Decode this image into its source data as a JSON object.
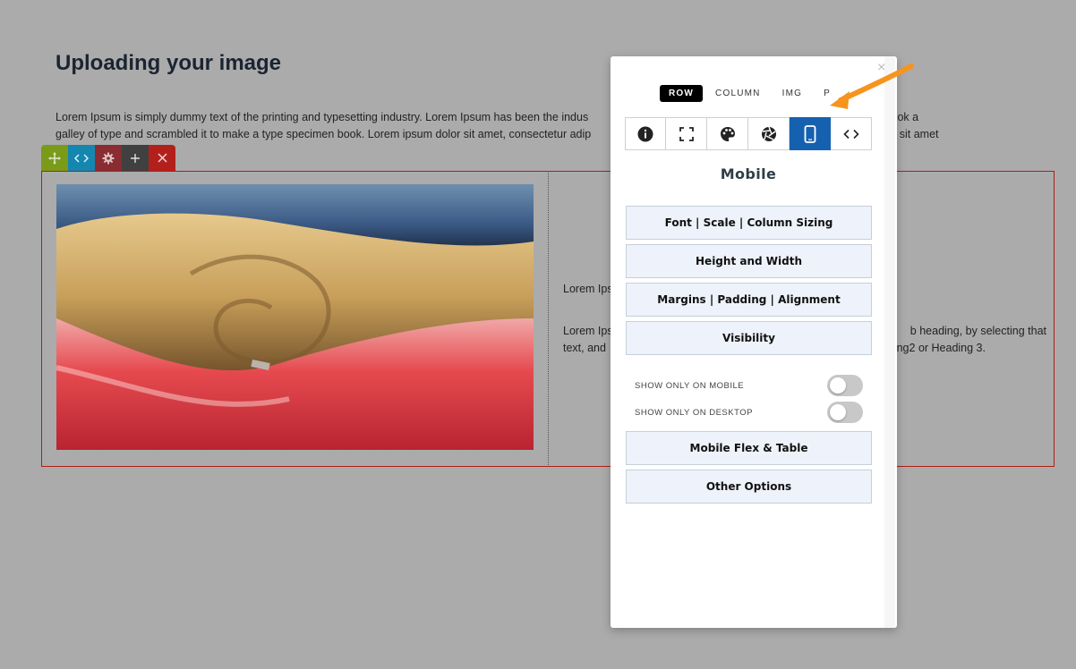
{
  "page": {
    "title": "Uploading your image",
    "intro_line1": "Lorem Ipsum is simply dummy text of the printing and typesetting industry. Lorem Ipsum has been the indus",
    "intro_line1_end": "n unknown printer took a",
    "intro_line2": "galley of type and scrambled it to make a type specimen book. Lorem ipsum dolor sit amet, consectetur adip",
    "intro_line2_end": "tate vel, dapibus sit amet"
  },
  "row_toolbar": {
    "move_icon": "move-icon",
    "code_icon": "code-icon",
    "settings_icon": "gear-icon",
    "add_icon": "plus-icon",
    "delete_icon": "close-icon"
  },
  "content": {
    "image_alt": "folded clothes",
    "column_text1": "Lorem Ips",
    "column_text2_left": "Lorem Ips",
    "column_text2_right": "b heading, by selecting that",
    "column_text3_left": "text, and",
    "column_text3_right": "ng2 or Heading 3."
  },
  "panel": {
    "close_label": "×",
    "scope_tabs": [
      "ROW",
      "COLUMN",
      "IMG",
      "P"
    ],
    "active_scope": "ROW",
    "icon_tabs": [
      "info-icon",
      "fullscreen-icon",
      "palette-icon",
      "aperture-icon",
      "mobile-icon",
      "code-icon"
    ],
    "active_icon_tab": "mobile-icon",
    "heading": "Mobile",
    "sections": {
      "font": "Font | Scale | Column Sizing",
      "height": "Height and Width",
      "margins": "Margins | Padding | Alignment",
      "visibility": "Visibility",
      "flex": "Mobile Flex & Table",
      "other": "Other Options"
    },
    "toggles": {
      "mobile_label": "SHOW ONLY ON MOBILE",
      "mobile_on": false,
      "desktop_label": "SHOW ONLY ON DESKTOP",
      "desktop_on": false
    }
  },
  "colors": {
    "backdrop": "#ababab",
    "row_outline": "#b01e14",
    "active_tab": "#1561b0",
    "arrow": "#f7941d"
  }
}
